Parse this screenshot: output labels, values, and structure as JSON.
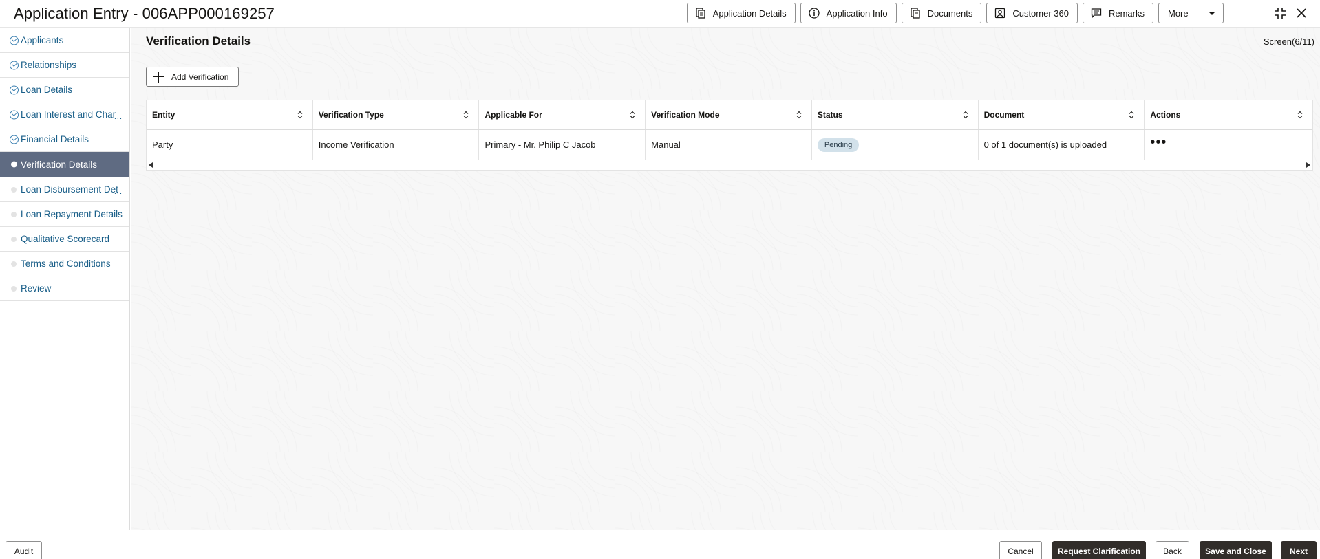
{
  "header": {
    "title": "Application Entry - 006APP000169257",
    "buttons": {
      "application_details": "Application Details",
      "application_info": "Application Info",
      "documents": "Documents",
      "customer_360": "Customer 360",
      "remarks": "Remarks",
      "more": "More"
    }
  },
  "sidebar": {
    "items": [
      {
        "label": "Applicants",
        "state": "done"
      },
      {
        "label": "Relationships",
        "state": "done"
      },
      {
        "label": "Loan Details",
        "state": "done"
      },
      {
        "label": "Loan Interest and Char",
        "state": "done",
        "truncated": true
      },
      {
        "label": "Financial Details",
        "state": "done"
      },
      {
        "label": "Verification Details",
        "state": "current"
      },
      {
        "label": "Loan Disbursement Det",
        "state": "todo",
        "truncated": true
      },
      {
        "label": "Loan Repayment Details",
        "state": "todo"
      },
      {
        "label": "Qualitative Scorecard",
        "state": "todo"
      },
      {
        "label": "Terms and Conditions",
        "state": "todo"
      },
      {
        "label": "Review",
        "state": "todo"
      }
    ],
    "ellipsis": "..."
  },
  "main": {
    "page_title": "Verification Details",
    "screen_counter": "Screen(6/11)",
    "add_button": "Add Verification",
    "table": {
      "columns": [
        "Entity",
        "Verification Type",
        "Applicable For",
        "Verification Mode",
        "Status",
        "Document",
        "Actions"
      ],
      "rows": [
        {
          "entity": "Party",
          "verification_type": "Income Verification",
          "applicable_for": "Primary - Mr. Philip C Jacob",
          "verification_mode": "Manual",
          "status": "Pending",
          "document": "0 of 1 document(s) is uploaded",
          "actions": "•••"
        }
      ]
    }
  },
  "footer": {
    "audit": "Audit",
    "cancel": "Cancel",
    "request_clarification": "Request Clarification",
    "back": "Back",
    "save_and_close": "Save and Close",
    "next": "Next"
  },
  "colors": {
    "active_nav": "#5f6b82",
    "link": "#1a5f89",
    "dark_button": "#312d2a",
    "status_badge": "#d2e1ea"
  }
}
